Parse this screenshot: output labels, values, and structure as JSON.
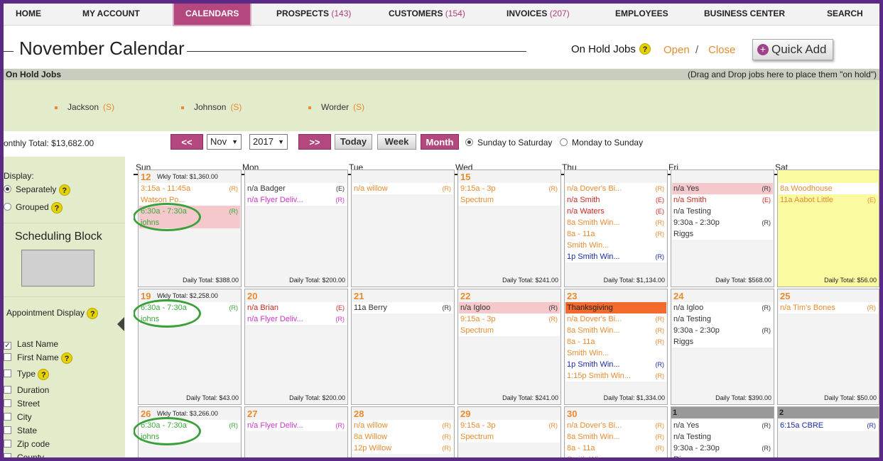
{
  "nav": {
    "home": "HOME",
    "account": "MY ACCOUNT",
    "calendars": "CALENDARS",
    "prospects": "PROSPECTS",
    "prospects_count": "(143)",
    "customers": "CUSTOMERS",
    "customers_count": "(154)",
    "invoices": "INVOICES",
    "invoices_count": "(207)",
    "employees": "EMPLOYEES",
    "business": "BUSINESS CENTER",
    "search": "SEARCH"
  },
  "header": {
    "title": "November Calendar",
    "onhold": "On Hold Jobs",
    "open": "Open",
    "slash": "/",
    "close": "Close",
    "quick_add": "Quick Add"
  },
  "onhold": {
    "title": "On Hold Jobs",
    "hint": "(Drag and Drop jobs here to place them \"on hold\")",
    "jobs": [
      {
        "name": "Jackson",
        "tag": "(S)"
      },
      {
        "name": "Johnson",
        "tag": "(S)"
      },
      {
        "name": "Worder",
        "tag": "(S)"
      }
    ]
  },
  "controls": {
    "prev": "<<",
    "next": ">>",
    "month_sel": "Nov",
    "year_sel": "2017",
    "today": "Today",
    "week": "Week",
    "month": "Month",
    "sun_sat": "Sunday to Saturday",
    "mon_sun": "Monday to Sunday"
  },
  "monthly_total": "onthly Total: $13,682.00",
  "sidebar": {
    "display": "Display:",
    "separately": "Separately",
    "grouped": "Grouped",
    "sched_title": "Scheduling Block",
    "appt_display": "Appointment Display",
    "fields": [
      "Last Name",
      "First Name",
      "Type",
      "Duration",
      "Street",
      "City",
      "State",
      "Zip code",
      "County"
    ]
  },
  "days": [
    "Sun",
    "Mon",
    "Tue",
    "Wed",
    "Thu",
    "Fri",
    "Sat"
  ],
  "week1": {
    "sun": {
      "daynum": "12",
      "weekly": "Wkly Total: $1,360.00",
      "e1": "3:15a - 11:45a",
      "e1t": "(R)",
      "e2": "Watson Po...",
      "e3": "6:30a - 7:30a",
      "e3t": "(R)",
      "e4": "johns",
      "total": "Daily Total: $388.00"
    },
    "mon": {
      "e1": "n/a Badger",
      "e1t": "(E)",
      "e2": "n/a Flyer Deliv...",
      "e2t": "(R)",
      "total": "Daily Total: $200.00"
    },
    "tue": {
      "e1": "n/a willow",
      "e1t": "(R)"
    },
    "wed": {
      "daynum": "15",
      "e1": "9:15a - 3p",
      "e1t": "(R)",
      "e2": "Spectrum",
      "total": "Daily Total: $241.00"
    },
    "thu": {
      "e1": "n/a Dover's Bi...",
      "e1t": "(R)",
      "e2": "n/a Smith",
      "e2t": "(E)",
      "e3": "n/a Waters",
      "e3t": "(E)",
      "e4": "8a  Smith Win...",
      "e4t": "(R)",
      "e5": "8a - 11a",
      "e5t": "(R)",
      "e6": "Smith Win...",
      "e7": "1p  Smith Win...",
      "e7t": "(R)",
      "total": "Daily Total: $1,134.00"
    },
    "fri": {
      "e1": "n/a Yes",
      "e1t": "(R)",
      "e2": "n/a Smith",
      "e2t": "(E)",
      "e3": "n/a Testing",
      "e4": "9:30a - 2:30p",
      "e4t": "(R)",
      "e5": "Riggs",
      "total": "Daily Total: $568.00"
    },
    "sat": {
      "e1": "8a    Woodhouse",
      "e2": "11a Aabot Little",
      "e2t": "(E)",
      "total": "Daily Total: $56.00"
    }
  },
  "week2": {
    "sun": {
      "daynum": "19",
      "weekly": "Wkly Total: $2,258.00",
      "e1": "6:30a - 7:30a",
      "e1t": "(R)",
      "e2": "johns",
      "total": "Daily Total: $43.00"
    },
    "mon": {
      "daynum": "20",
      "e1": "n/a Brian",
      "e1t": "(E)",
      "e2": "n/a Flyer Deliv...",
      "e2t": "(R)",
      "total": "Daily Total: $200.00"
    },
    "tue": {
      "daynum": "21",
      "e1": "11a Berry",
      "e1t": "(R)"
    },
    "wed": {
      "daynum": "22",
      "e1": "n/a Igloo",
      "e1t": "(R)",
      "e2": "9:15a - 3p",
      "e2t": "(R)",
      "e3": "Spectrum",
      "total": "Daily Total: $241.00"
    },
    "thu": {
      "daynum": "23",
      "e1": "Thanksgiving",
      "e2": "n/a    Dover's Bi...",
      "e2t": "(R)",
      "e3": "8a     Smith Win...",
      "e3t": "(R)",
      "e4": "8a - 11a",
      "e4t": "(R)",
      "e5": "Smith Win...",
      "e6": "1p     Smith Win...",
      "e6t": "(R)",
      "e7": "1:15p Smith Win...",
      "e7t": "(R)",
      "total": "Daily Total: $1,334.00"
    },
    "fri": {
      "daynum": "24",
      "e1": "n/a Igloo",
      "e1t": "(R)",
      "e2": "n/a Testing",
      "e3": "9:30a - 2:30p",
      "e3t": "(R)",
      "e4": "Riggs",
      "total": "Daily Total: $390.00"
    },
    "sat": {
      "daynum": "25",
      "e1": "n/a Tim's Bones",
      "e1t": "(R)",
      "total": "Daily Total: $50.00"
    }
  },
  "week3": {
    "sun": {
      "daynum": "26",
      "weekly": "Wkly Total: $3,266.00",
      "e1": "6:30a - 7:30a",
      "e1t": "(R)",
      "e2": "johns"
    },
    "mon": {
      "daynum": "27",
      "e1": "n/a Flyer Deliv...",
      "e1t": "(R)"
    },
    "tue": {
      "daynum": "28",
      "e1": "n/a  willow",
      "e1t": "(R)",
      "e2": "8a   Willow",
      "e2t": "(R)",
      "e3": "12p Willow",
      "e3t": "(R)"
    },
    "wed": {
      "daynum": "29",
      "e1": "9:15a - 3p",
      "e1t": "(R)",
      "e2": "Spectrum"
    },
    "thu": {
      "daynum": "30",
      "e1": "n/a Dover's Bi...",
      "e1t": "(R)",
      "e2": "8a  Smith Win...",
      "e2t": "(R)",
      "e3": "8a - 11a",
      "e3t": "(R)",
      "e4": "Smith Win..."
    },
    "fri": {
      "daynum": "1",
      "e1": "n/a Yes",
      "e1t": "(R)",
      "e2": "n/a Testing",
      "e3": "9:30a - 2:30p",
      "e3t": "(R)",
      "e4": "Riggs"
    },
    "sat": {
      "daynum": "2",
      "e1": "6:15a CBRE",
      "e1t": "(R)"
    }
  }
}
